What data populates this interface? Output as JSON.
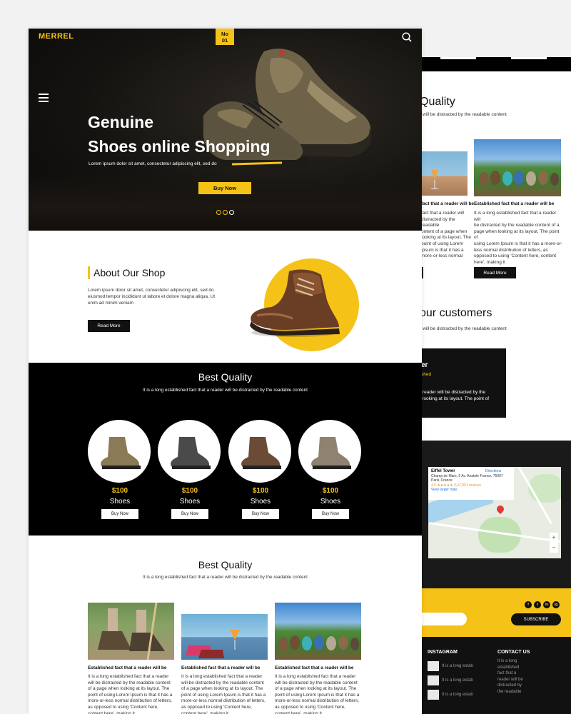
{
  "back": {
    "quality_title": "Quality",
    "quality_sub": "will be distracted by the readable content",
    "card_a": {
      "heading": "fact that a reader will be",
      "body": [
        "fact that a reader will",
        "distracted by the readable",
        "ontent of a page when",
        "looking at its layout. The",
        "point of using Lorem",
        "Ipsum is that it has a",
        "more-or-less normal",
        "distribution of letters, as",
        "opposed to using",
        "'Content here, content"
      ]
    },
    "card_b": {
      "heading": "Established fact that a reader will be",
      "body": [
        "It is a long established fact that a reader will",
        "be distracted by the readable content of a",
        "page when looking at its layout. The point of",
        "using Lorem Ipsum is that it has a more-or-",
        "less normal distribution of letters, as",
        "opposed to using 'Content here, content",
        "here', making it"
      ],
      "button": "Read More"
    },
    "customers_title": "our customers",
    "customers_sub": "will be distracted by the readable content",
    "testimonial": {
      "name": "er",
      "role": "shed",
      "quote": [
        "reader will be distracted by the",
        "looking at its layout. The point of"
      ]
    },
    "map": {
      "place": "Eiffel Tower",
      "address": "Champ de Mars, 5 Av. Anatole France, 75007 Paris, France",
      "rating": "4.5 ★★★★★ 3,47,961 reviews",
      "directions": "Directions",
      "larger_map": "View larger map",
      "zoom_in": "+",
      "zoom_out": "−"
    },
    "subscribe": "SUBSCRIBE",
    "social": [
      "f",
      "t",
      "in",
      "ig"
    ],
    "instagram_heading": "INSTAGRAM",
    "instagram_items": [
      "It is a long estab",
      "It is a long estab",
      "It is a long estab"
    ],
    "contact_heading": "CONTACT US",
    "contact_text": [
      "It is a long",
      "established",
      "fact that a",
      "reader will be",
      "distracted by",
      "the readable"
    ]
  },
  "nav": {
    "logo": "MERREL",
    "badge_top": "No",
    "badge_bottom": "01"
  },
  "hero": {
    "title_line1": "Genuine",
    "title_line2": "Shoes online Shopping",
    "lead": "Lorem ipsum dolor sit amet, consectetur adipiscing elit, sed do",
    "button": "Buy Now",
    "slides": 3,
    "active_slide": 3
  },
  "about": {
    "title": "About Our Shop",
    "text": "Lorem ipsum dolor sit amet, consectetur adipiscing elit, sed do eiusmod tempor incididunt ut labore et dolore magna aliqua. Ut enim ad minim veniam",
    "button": "Read More"
  },
  "best_quality": {
    "title": "Best Quality",
    "subtitle": "It is a long established fact that a reader will be distracted by the readable content",
    "products": [
      {
        "price": "$100",
        "name": "Shoes",
        "button": "Buy Now",
        "color": "#8a7a55"
      },
      {
        "price": "$100",
        "name": "Shoes",
        "button": "Buy Now",
        "color": "#4a4a4a"
      },
      {
        "price": "$100",
        "name": "Shoes",
        "button": "Buy Now",
        "color": "#6b4a36"
      },
      {
        "price": "$100",
        "name": "Shoes",
        "button": "Buy Now",
        "color": "#8f8270"
      }
    ]
  },
  "blog": {
    "title": "Best Quality",
    "subtitle": "It is a long established fact that a reader will be distracted by the readable content",
    "cards": [
      {
        "heading": "Established fact that a reader will be",
        "body": "It is a long established fact that a reader will be distracted by the readable content of a page when looking at its layout. The point of using Lorem Ipsum is that it has a more-or-less normal distribution of letters, as opposed to using 'Content here, content here', making it"
      },
      {
        "heading": "Established fact that a reader will be",
        "body": "It is a long established fact that a reader will be distracted by the readable content of a page when looking at its layout. The point of using Lorem Ipsum is that it has a more-or-less normal distribution of letters, as opposed to using 'Content here, content here', making it"
      },
      {
        "heading": "Established fact that a reader will be",
        "body": "It is a long established fact that a reader will be distracted by the readable content of a page when looking at its layout. The point of using Lorem Ipsum is that it has a more-or-less normal distribution of letters, as opposed to using 'Content here, content here', making it"
      }
    ]
  },
  "colors": {
    "accent": "#f5c218",
    "dark": "#111111"
  }
}
